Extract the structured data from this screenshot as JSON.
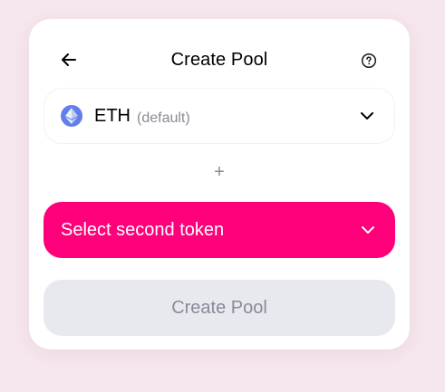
{
  "header": {
    "title": "Create Pool",
    "back_icon": "arrow-left-icon",
    "help_icon": "question-circle-icon"
  },
  "token_a": {
    "symbol": "ETH",
    "note": "(default)",
    "icon": "ethereum-icon",
    "chevron_icon": "chevron-down-icon"
  },
  "separator": {
    "symbol": "+"
  },
  "token_b": {
    "label": "Select second token",
    "chevron_icon": "chevron-down-icon"
  },
  "submit": {
    "label": "Create Pool",
    "disabled": true
  },
  "colors": {
    "accent": "#ff007a",
    "background": "#f6e6ee",
    "card": "#ffffff",
    "disabled_button": "#e8e9ef",
    "muted_text": "#8a8a98",
    "eth_blue": "#627eea"
  }
}
